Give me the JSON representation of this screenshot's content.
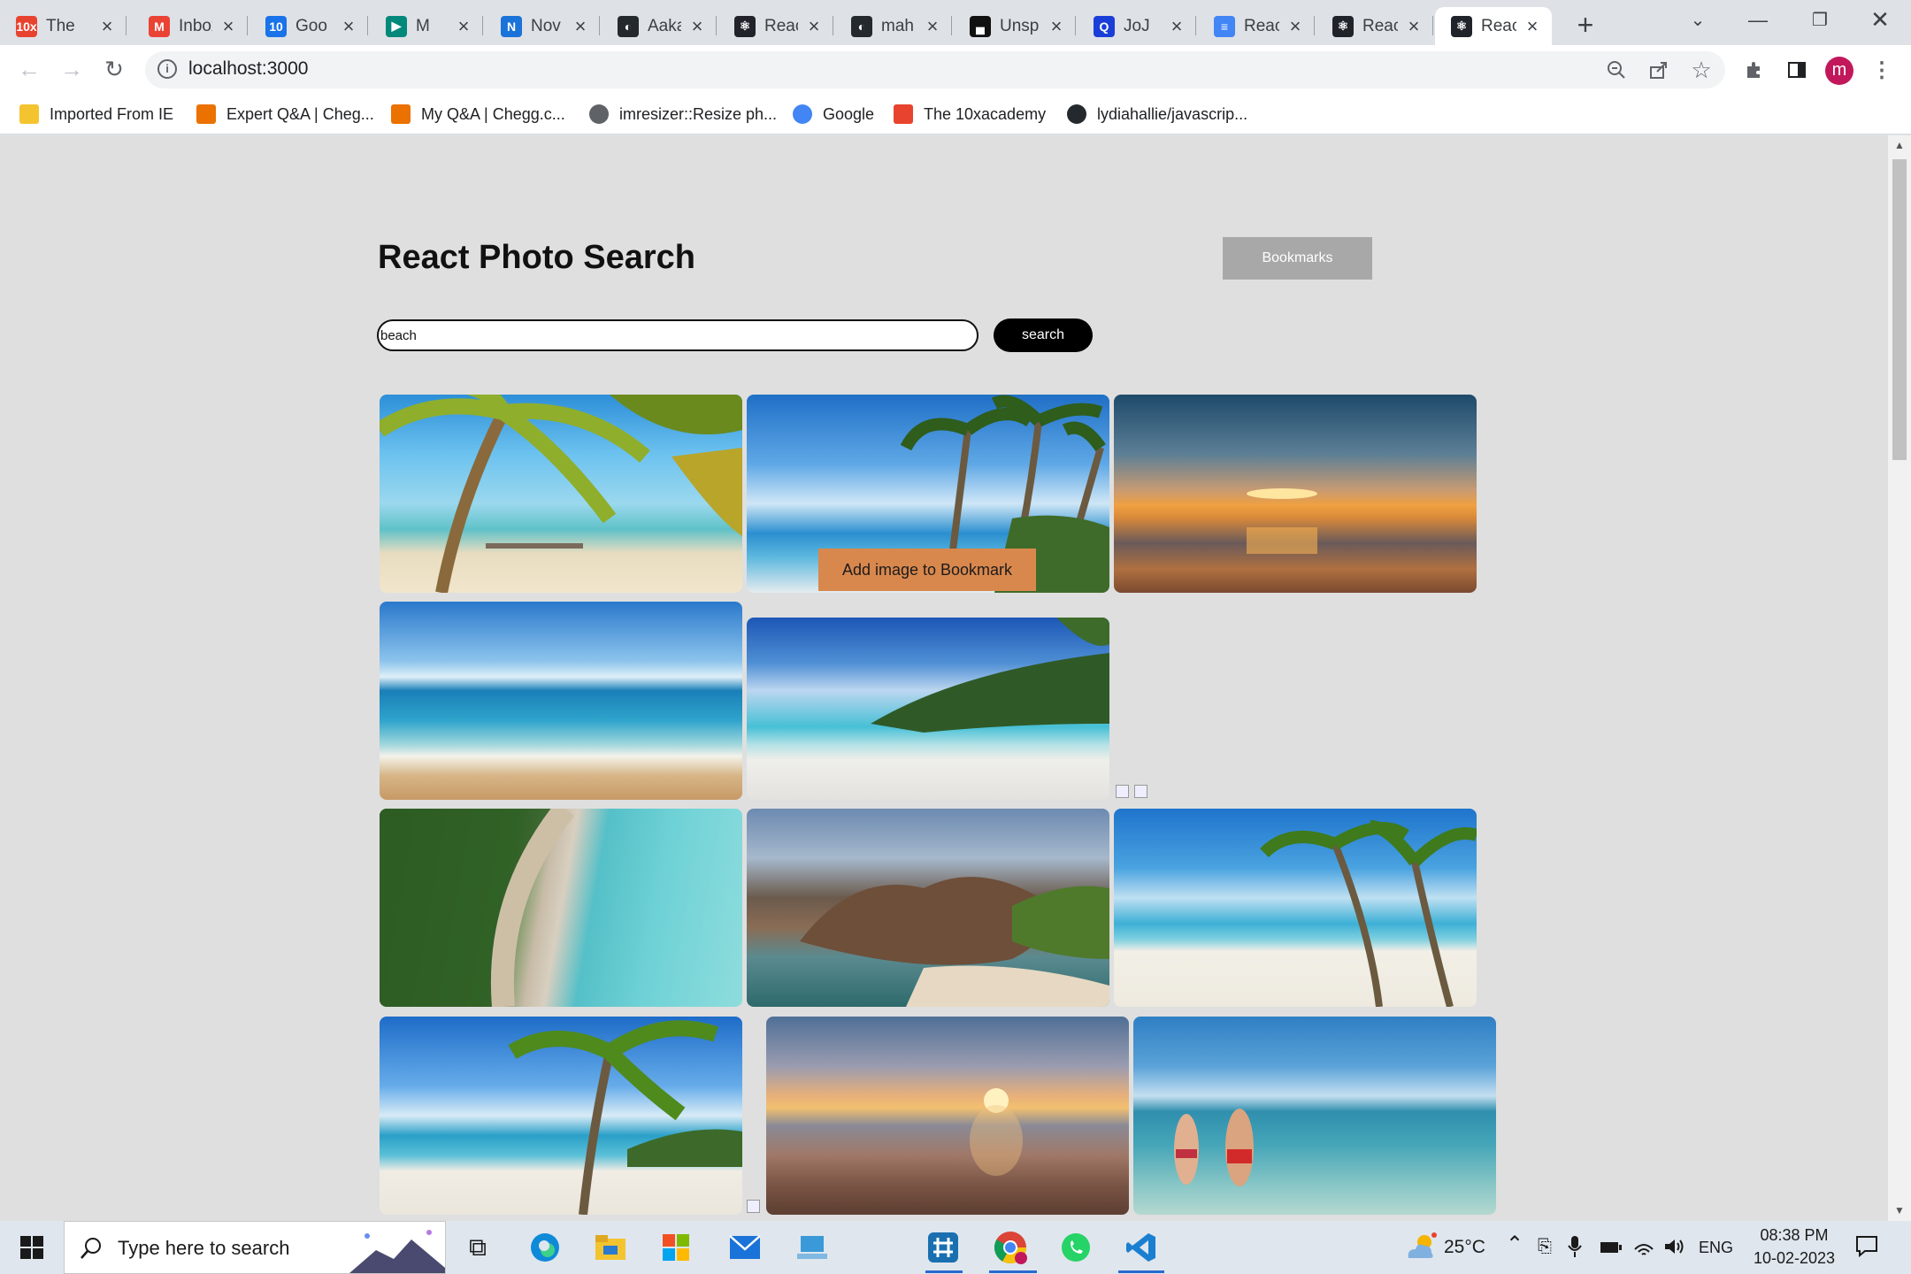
{
  "browser": {
    "tabs": [
      {
        "title": "The",
        "favicon": "10x-icon"
      },
      {
        "title": "Inbox",
        "favicon": "gmail-icon"
      },
      {
        "title": "Goo",
        "favicon": "calendar-icon"
      },
      {
        "title": "M",
        "favicon": "meet-icon"
      },
      {
        "title": "Nov",
        "favicon": "notion-icon"
      },
      {
        "title": "Aaka",
        "favicon": "github-icon"
      },
      {
        "title": "Reac",
        "favicon": "react-icon"
      },
      {
        "title": "mah",
        "favicon": "github-icon"
      },
      {
        "title": "Unsp",
        "favicon": "unsplash-icon"
      },
      {
        "title": "JoJ",
        "favicon": "search-icon"
      },
      {
        "title": "Reac",
        "favicon": "docs-icon"
      },
      {
        "title": "Reac",
        "favicon": "react-icon"
      },
      {
        "title": "Reac",
        "favicon": "react-icon"
      }
    ],
    "url": "localhost:3000",
    "profile_initial": "m",
    "bookmarks": [
      {
        "label": "Imported From IE",
        "icon": "folder-icon"
      },
      {
        "label": "Expert Q&A | Cheg...",
        "icon": "chegg-icon"
      },
      {
        "label": "My Q&A | Chegg.c...",
        "icon": "chegg-icon"
      },
      {
        "label": "imresizer::Resize ph...",
        "icon": "globe-icon"
      },
      {
        "label": "Google",
        "icon": "google-icon"
      },
      {
        "label": "The 10xacademy",
        "icon": "10x-icon"
      },
      {
        "label": "lydiahallie/javascrip...",
        "icon": "github-icon"
      }
    ]
  },
  "app": {
    "title": "React Photo Search",
    "bookmarks_button": "Bookmarks",
    "search_value": "beach",
    "search_button": "search",
    "hover_overlay": "Add image to Bookmark"
  },
  "photos": [
    {
      "subject": "palm beach with jetty"
    },
    {
      "subject": "palm trees blue sky"
    },
    {
      "subject": "sunset over sea"
    },
    {
      "subject": "waves on sand"
    },
    {
      "subject": "white beach green hill"
    },
    {
      "subject": "aerial forest coastline"
    },
    {
      "subject": "rocky beach lagoon"
    },
    {
      "subject": "tropical palm beach"
    },
    {
      "subject": "palm tree on beach"
    },
    {
      "subject": "sunset on sand"
    },
    {
      "subject": "couple walking in sea"
    }
  ],
  "taskbar": {
    "search_placeholder": "Type here to search",
    "temperature": "25°C",
    "language": "ENG",
    "time": "08:38 PM",
    "date": "10-02-2023"
  },
  "colors": {
    "accent_overlay": "#d9884d",
    "bookmarks_button": "#a8a8a8",
    "search_button": "#000000"
  }
}
